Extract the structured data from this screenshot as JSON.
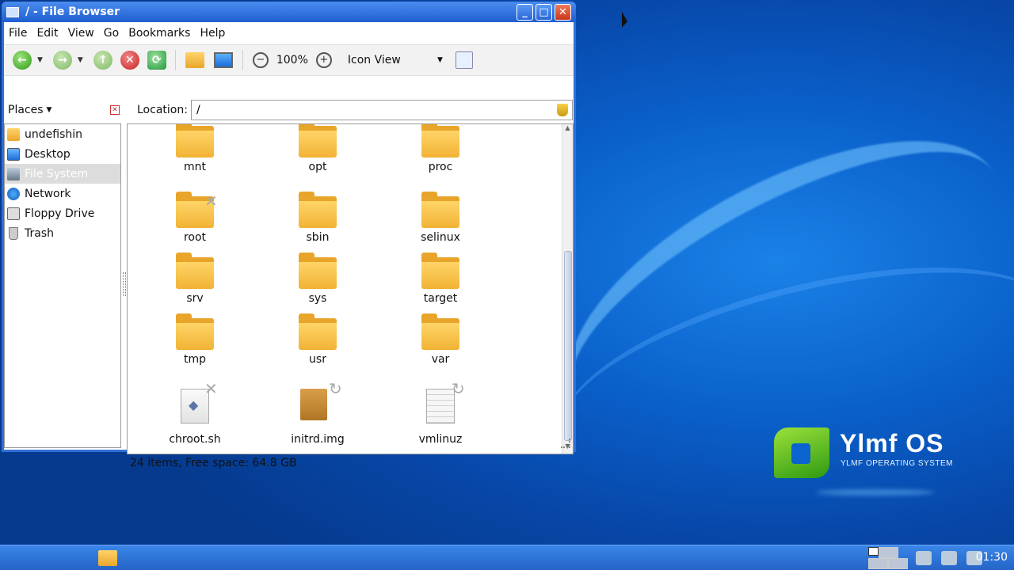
{
  "window": {
    "title": "/ - File Browser"
  },
  "menubar": [
    {
      "label": "File",
      "mnemonic": "F"
    },
    {
      "label": "Edit",
      "mnemonic": "E"
    },
    {
      "label": "View",
      "mnemonic": "V"
    },
    {
      "label": "Go",
      "mnemonic": "G"
    },
    {
      "label": "Bookmarks",
      "mnemonic": "B"
    },
    {
      "label": "Help",
      "mnemonic": "H"
    }
  ],
  "toolbar": {
    "zoom": "100%",
    "view_mode": "Icon View"
  },
  "sidebar": {
    "header": "Places",
    "items": [
      {
        "label": "undefishin",
        "icon": "home-folder-icon"
      },
      {
        "label": "Desktop",
        "icon": "desktop-icon"
      },
      {
        "label": "File System",
        "icon": "drive-icon",
        "selected": true
      },
      {
        "label": "Network",
        "icon": "network-icon"
      },
      {
        "label": "Floppy Drive",
        "icon": "floppy-icon"
      },
      {
        "label": "Trash",
        "icon": "trash-icon"
      }
    ]
  },
  "location": {
    "label": "Location:",
    "value": "/"
  },
  "files": [
    {
      "name": "mnt",
      "type": "folder"
    },
    {
      "name": "opt",
      "type": "folder"
    },
    {
      "name": "proc",
      "type": "folder"
    },
    {
      "name": "root",
      "type": "folder",
      "badge": "locked-x"
    },
    {
      "name": "sbin",
      "type": "folder"
    },
    {
      "name": "selinux",
      "type": "folder"
    },
    {
      "name": "srv",
      "type": "folder"
    },
    {
      "name": "sys",
      "type": "folder"
    },
    {
      "name": "target",
      "type": "folder"
    },
    {
      "name": "tmp",
      "type": "folder"
    },
    {
      "name": "usr",
      "type": "folder"
    },
    {
      "name": "var",
      "type": "folder"
    },
    {
      "name": "chroot.sh",
      "type": "script",
      "badge": "locked-x"
    },
    {
      "name": "initrd.img",
      "type": "archive",
      "badge": "symlink"
    },
    {
      "name": "vmlinuz",
      "type": "textdoc",
      "badge": "symlink"
    }
  ],
  "status": "24 items, Free space: 64.8 GB",
  "desktop": {
    "logo_title": "Ylmf OS",
    "logo_subtitle": "YLMF OPERATING SYSTEM"
  },
  "taskbar": {
    "clock": "01:30"
  }
}
